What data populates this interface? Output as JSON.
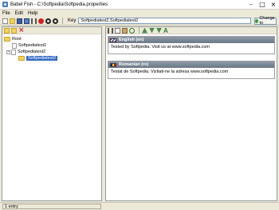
{
  "window": {
    "title": "Babel Fish - C:\\Softpedia\\Softpedia.properties"
  },
  "menu": {
    "items": [
      "File",
      "Edit",
      "Help"
    ]
  },
  "toolbar": {
    "key_label": "Key",
    "key_value": "Softpediatest2.Softpediatest2",
    "change_button": "Change to"
  },
  "tree": {
    "root": "Root",
    "items": [
      {
        "label": "Softpediatest1"
      },
      {
        "label": "Softpediatest2"
      },
      {
        "label": "Softpediatest2"
      }
    ]
  },
  "languages": [
    {
      "name": "English (en)",
      "text": "Tested by Softpedia. Visit us at www.softpedia.com",
      "flag": "en"
    },
    {
      "name": "Romanian (ro)",
      "text": "Testat de Softpedia. Vizitati-ne la adresa www.softpedia.com",
      "flag": "ro"
    }
  ],
  "status": {
    "text": "1 entry"
  },
  "colors": {
    "selection": "#316ac5",
    "chrome": "#ece9d8",
    "panel_header": "#7b8794"
  }
}
